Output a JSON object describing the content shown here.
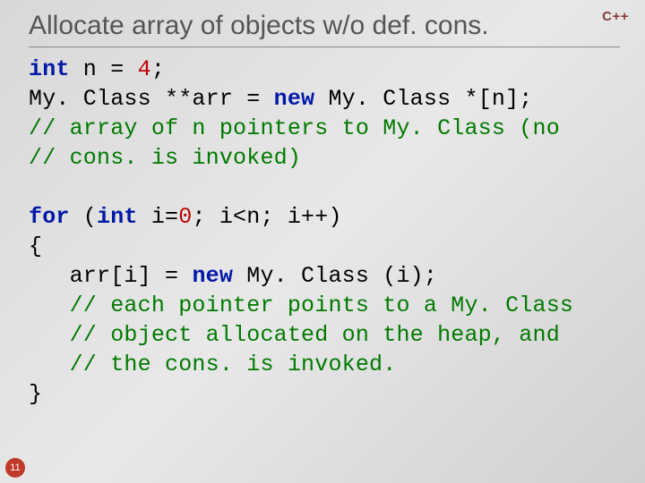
{
  "title": "Allocate array of objects w/o def. cons.",
  "language_badge": "C++",
  "slide_number": "11",
  "code": {
    "l1_kw1": "int",
    "l1_txt1": " n = ",
    "l1_num1": "4",
    "l1_txt2": ";",
    "l2_txt1": "My. Class **arr = ",
    "l2_kw1": "new",
    "l2_txt2": " My. Class *[n];",
    "l3_cm": "// array of n pointers to My. Class (no",
    "l4_cm": "// cons. is invoked)",
    "blank1": "",
    "l5_kw1": "for",
    "l5_txt1": " (",
    "l5_kw2": "int",
    "l5_txt2": " i=",
    "l5_num1": "0",
    "l5_txt3": "; i<n; i++)",
    "l6_txt": "{",
    "l7_txt1": "   arr[i] = ",
    "l7_kw1": "new",
    "l7_txt2": " My. Class (i);",
    "l8_cm": "   // each pointer points to a My. Class",
    "l9_cm": "   // object allocated on the heap, and",
    "l10_cm": "   // the cons. is invoked.",
    "l11_txt": "}"
  }
}
